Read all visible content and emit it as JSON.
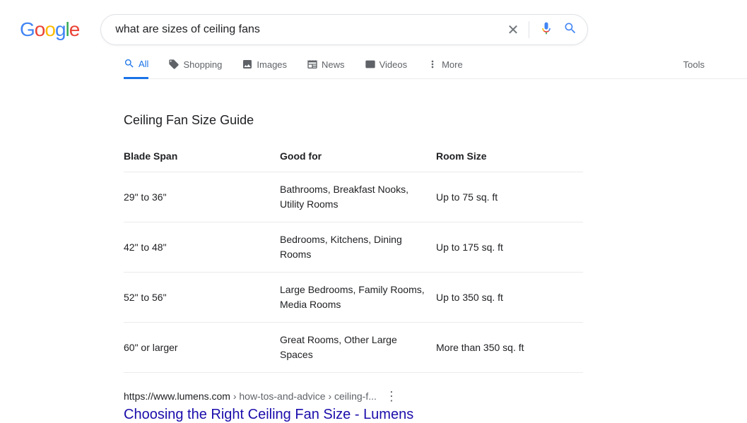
{
  "logo": {
    "g1": "G",
    "o1": "o",
    "o2": "o",
    "g2": "g",
    "l": "l",
    "e": "e"
  },
  "search": {
    "query": "what are sizes of ceiling fans"
  },
  "tabs": {
    "all": "All",
    "shopping": "Shopping",
    "images": "Images",
    "news": "News",
    "videos": "Videos",
    "more": "More",
    "tools": "Tools"
  },
  "snippet": {
    "title": "Ceiling Fan Size Guide",
    "headers": {
      "c1": "Blade Span",
      "c2": "Good for",
      "c3": "Room Size"
    },
    "rows": [
      {
        "c1": "29\" to 36\"",
        "c2": "Bathrooms, Breakfast Nooks, Utility Rooms",
        "c3": "Up to 75 sq. ft"
      },
      {
        "c1": "42\" to 48\"",
        "c2": "Bedrooms, Kitchens, Dining Rooms",
        "c3": "Up to 175 sq. ft"
      },
      {
        "c1": "52\" to 56\"",
        "c2": "Large Bedrooms, Family Rooms, Media Rooms",
        "c3": "Up to 350 sq. ft"
      },
      {
        "c1": "60\" or larger",
        "c2": "Great Rooms, Other Large Spaces",
        "c3": "More than 350 sq. ft"
      }
    ]
  },
  "result": {
    "cite_domain": "https://www.lumens.com",
    "cite_path": " › how-tos-and-advice › ceiling-f...",
    "title": "Choosing the Right Ceiling Fan Size - Lumens"
  }
}
